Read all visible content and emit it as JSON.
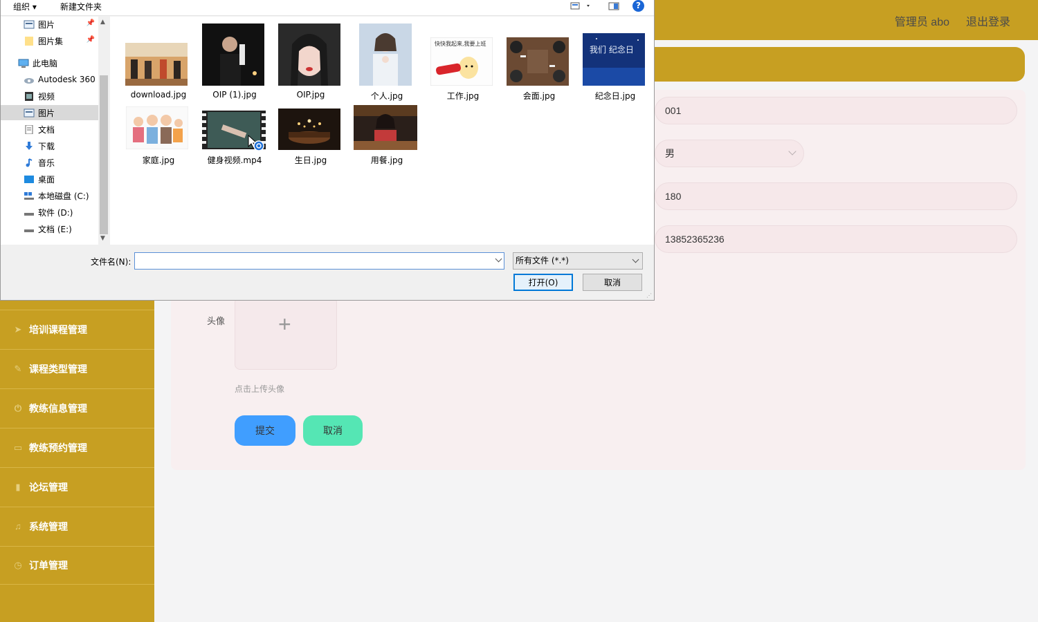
{
  "header": {
    "admin_label": "管理员 abo",
    "logout_label": "退出登录"
  },
  "sidebar": {
    "items": [
      {
        "label": "培训课程管理",
        "icon": "paper-plane-icon"
      },
      {
        "label": "课程类型管理",
        "icon": "edit-icon"
      },
      {
        "label": "教练信息管理",
        "icon": "power-icon"
      },
      {
        "label": "教练预约管理",
        "icon": "tablet-icon"
      },
      {
        "label": "论坛管理",
        "icon": "bar-chart-icon"
      },
      {
        "label": "系统管理",
        "icon": "microphone-icon"
      },
      {
        "label": "订单管理",
        "icon": "clock-icon"
      }
    ]
  },
  "form": {
    "id_value": "001",
    "gender_value": "男",
    "height_value": "180",
    "phone_value": "13852365236",
    "avatar_label": "头像",
    "upload_hint": "点击上传头像",
    "submit_label": "提交",
    "cancel_label": "取消"
  },
  "dialog": {
    "toolbar": {
      "organize": "组织 ▾",
      "new_folder": "新建文件夹",
      "help": "?"
    },
    "nav": [
      {
        "label": "图片",
        "pinned": true
      },
      {
        "label": "图片集",
        "pinned": true
      },
      {
        "label": "此电脑"
      },
      {
        "label": "Autodesk 360"
      },
      {
        "label": "视频"
      },
      {
        "label": "图片",
        "selected": true
      },
      {
        "label": "文档"
      },
      {
        "label": "下载"
      },
      {
        "label": "音乐"
      },
      {
        "label": "桌面"
      },
      {
        "label": "本地磁盘 (C:)"
      },
      {
        "label": "软件 (D:)"
      },
      {
        "label": "文档 (E:)"
      }
    ],
    "files": [
      {
        "name": "download.jpg"
      },
      {
        "name": "OIP (1).jpg"
      },
      {
        "name": "OIP.jpg"
      },
      {
        "name": "个人.jpg"
      },
      {
        "name": "工作.jpg"
      },
      {
        "name": "会面.jpg"
      },
      {
        "name": "纪念日.jpg"
      },
      {
        "name": "家庭.jpg"
      },
      {
        "name": "健身视频.mp4"
      },
      {
        "name": "生日.jpg"
      },
      {
        "name": "用餐.jpg"
      }
    ],
    "filename_label": "文件名(N):",
    "filename_value": "",
    "filetype": "所有文件 (*.*)",
    "open_label": "打开(O)",
    "cancel_label": "取消",
    "thumb_captions": {
      "gongzuo": "快快我起来,我要上班",
      "jinian": "我们 纪念日"
    }
  }
}
